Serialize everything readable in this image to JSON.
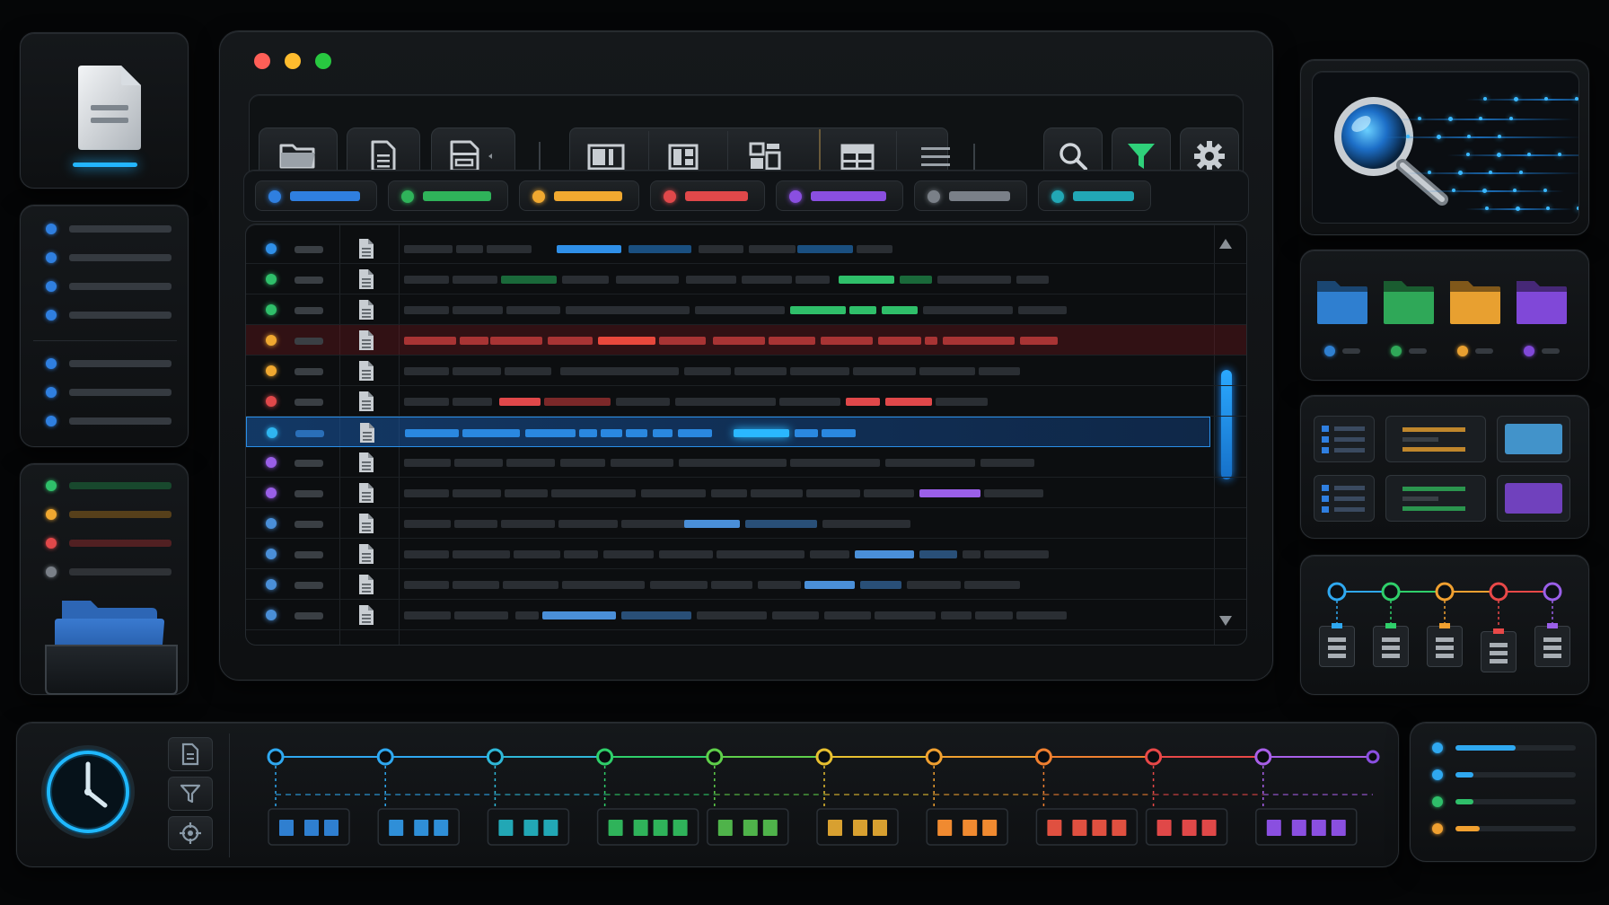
{
  "window": {
    "controls": [
      {
        "name": "close",
        "color": "#ff5f57"
      },
      {
        "name": "minimize",
        "color": "#febc2e"
      },
      {
        "name": "zoom",
        "color": "#28c840"
      }
    ]
  },
  "toolbar": {
    "file_buttons": [
      "folder-icon",
      "document-icon",
      "archive-icon"
    ],
    "layout_buttons": [
      "columns-icon",
      "split-icon",
      "grid-icon",
      "table-icon",
      "list-icon"
    ],
    "action_buttons": [
      "search-icon",
      "filter-icon",
      "gear-icon"
    ]
  },
  "filter_chips": [
    {
      "name": "blue",
      "color": "#2f7fe0"
    },
    {
      "name": "green",
      "color": "#2fb35a"
    },
    {
      "name": "orange",
      "color": "#f0a830"
    },
    {
      "name": "red",
      "color": "#e0484a"
    },
    {
      "name": "purple",
      "color": "#8a4fe0"
    },
    {
      "name": "gray",
      "color": "#7a8088"
    },
    {
      "name": "teal",
      "color": "#22a7b5"
    }
  ],
  "rows": [
    {
      "dot": "#2f8fe8",
      "state": "normal"
    },
    {
      "dot": "#2fbf6a",
      "state": "normal"
    },
    {
      "dot": "#2fbf6a",
      "state": "normal"
    },
    {
      "dot": "#f0a830",
      "state": "error"
    },
    {
      "dot": "#f0a830",
      "state": "normal"
    },
    {
      "dot": "#e0484a",
      "state": "normal"
    },
    {
      "dot": "#2fb5f0",
      "state": "selected"
    },
    {
      "dot": "#9a5fe8",
      "state": "normal"
    },
    {
      "dot": "#9a5fe8",
      "state": "normal"
    },
    {
      "dot": "#4a8fd8",
      "state": "normal"
    },
    {
      "dot": "#4a8fd8",
      "state": "normal"
    },
    {
      "dot": "#4a8fd8",
      "state": "normal"
    },
    {
      "dot": "#4a8fd8",
      "state": "normal"
    }
  ],
  "scrollbar": {
    "position": 0.42
  },
  "left_sidebar": {
    "list_dots": [
      "#2f7fe0",
      "#2f7fe0",
      "#2f7fe0",
      "#2f7fe0",
      "#2f7fe0",
      "#2f7fe0",
      "#2f7fe0"
    ],
    "status_dots": [
      "#2fbf6a",
      "#f0a830",
      "#e0484a",
      "#7a8088"
    ]
  },
  "right_sidebar": {
    "folders": [
      {
        "name": "blue",
        "color": "#2f7fd0"
      },
      {
        "name": "green",
        "color": "#2fa858"
      },
      {
        "name": "orange",
        "color": "#e8a030"
      },
      {
        "name": "purple",
        "color": "#8048d8"
      }
    ],
    "flow_nodes": [
      "#2fa8f0",
      "#2fcf6a",
      "#f0a030",
      "#e84848",
      "#9a5fe8"
    ],
    "progress": [
      {
        "color": "#2fa8f0",
        "level": 0.5
      },
      {
        "color": "#2fa8f0",
        "level": 0.15
      },
      {
        "color": "#2fbf6a",
        "level": 0.15
      },
      {
        "color": "#f0a030",
        "level": 0.2
      }
    ]
  },
  "timeline": {
    "nodes": [
      "#2fa8f0",
      "#2fa8f0",
      "#2fb8d8",
      "#2fcf6a",
      "#5fcf4a",
      "#e8c030",
      "#f0a030",
      "#f08030",
      "#e84848",
      "#a85fe8",
      "#8a4fe0"
    ],
    "groups": [
      {
        "color": "#2f7fd0",
        "count": 3
      },
      {
        "color": "#2f8fd8",
        "count": 3
      },
      {
        "color": "#22a7b5",
        "count": 3
      },
      {
        "color": "#2fb35a",
        "count": 4
      },
      {
        "color": "#4fb34a",
        "count": 3
      },
      {
        "color": "#d8a030",
        "count": 3
      },
      {
        "color": "#f08a30",
        "count": 3
      },
      {
        "color": "#e05040",
        "count": 4
      },
      {
        "color": "#e04848",
        "count": 3
      },
      {
        "color": "#8a4fe0",
        "count": 4
      }
    ]
  }
}
